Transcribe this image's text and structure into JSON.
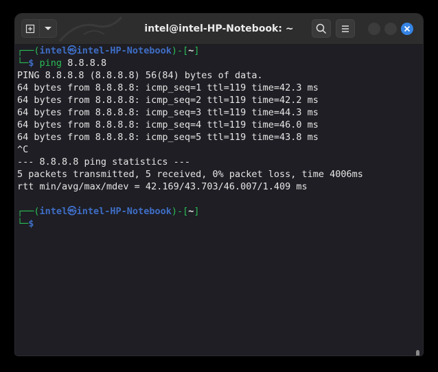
{
  "window": {
    "title": "intel@intel-HP-Notebook: ~"
  },
  "titlebar": {
    "new_tab_icon": "new-tab-icon",
    "dropdown_icon": "chevron-down-icon",
    "search_icon": "search-icon",
    "menu_icon": "hamburger-menu-icon",
    "close_color": "#3584e4"
  },
  "colors": {
    "prompt_green": "#2bbd56",
    "prompt_blue": "#3f6ec6",
    "text": "#e6e6e6",
    "background": "#1e1e24"
  },
  "prompt": {
    "corner_top": "┌──(",
    "user": "intel",
    "at_symbol": "㉿",
    "host": "intel-HP-Notebook",
    "close_paren": ")-[",
    "cwd": "~",
    "close_bracket": "]",
    "corner_bottom": "└─",
    "dollar": "$"
  },
  "command": {
    "name": "ping",
    "arg": "8.8.8.8"
  },
  "output": [
    "PING 8.8.8.8 (8.8.8.8) 56(84) bytes of data.",
    "64 bytes from 8.8.8.8: icmp_seq=1 ttl=119 time=42.3 ms",
    "64 bytes from 8.8.8.8: icmp_seq=2 ttl=119 time=42.2 ms",
    "64 bytes from 8.8.8.8: icmp_seq=3 ttl=119 time=44.3 ms",
    "64 bytes from 8.8.8.8: icmp_seq=4 ttl=119 time=46.0 ms",
    "64 bytes from 8.8.8.8: icmp_seq=5 ttl=119 time=43.8 ms",
    "^C",
    "--- 8.8.8.8 ping statistics ---",
    "5 packets transmitted, 5 received, 0% packet loss, time 4006ms",
    "rtt min/avg/max/mdev = 42.169/43.703/46.007/1.409 ms"
  ]
}
